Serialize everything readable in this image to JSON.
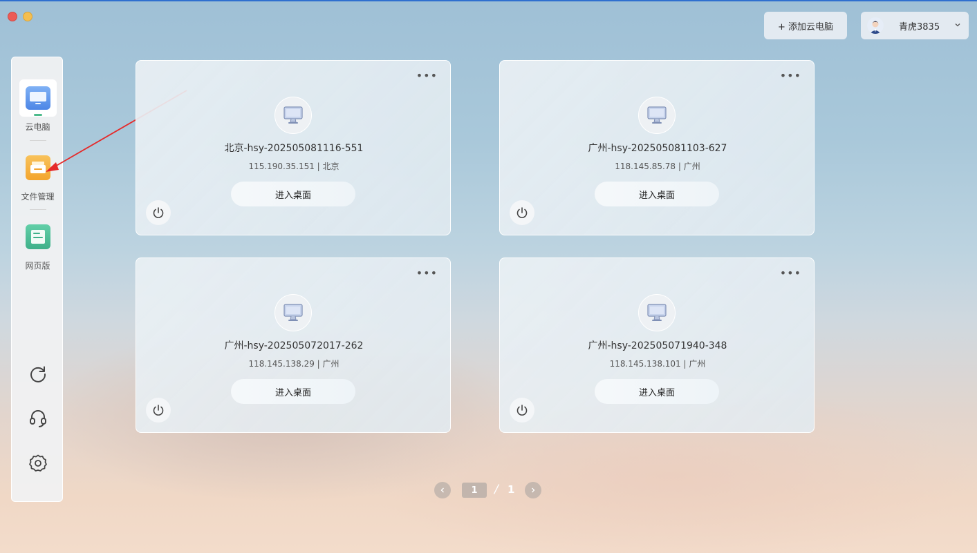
{
  "window": {
    "controls": [
      "close",
      "minimize"
    ]
  },
  "header": {
    "add_button": "+ 添加云电脑",
    "user": {
      "name": "青虎3835",
      "avatar_icon": "user-avatar-icon"
    }
  },
  "sidebar": {
    "items": [
      {
        "label": "云电脑",
        "icon": "monitor-icon",
        "active": true
      },
      {
        "label": "文件管理",
        "icon": "folder-icon",
        "active": false
      },
      {
        "label": "网页版",
        "icon": "web-page-icon",
        "active": false
      }
    ],
    "tools": [
      {
        "icon": "refresh-icon"
      },
      {
        "icon": "headset-icon"
      },
      {
        "icon": "settings-icon"
      }
    ]
  },
  "cards": [
    {
      "name": "北京-hsy-202505081116-551",
      "ip": "115.190.35.151 | 北京",
      "enter": "进入桌面"
    },
    {
      "name": "广州-hsy-202505081103-627",
      "ip": "118.145.85.78 | 广州",
      "enter": "进入桌面"
    },
    {
      "name": "广州-hsy-202505072017-262",
      "ip": "118.145.138.29 | 广州",
      "enter": "进入桌面"
    },
    {
      "name": "广州-hsy-202505071940-348",
      "ip": "118.145.138.101 | 广州",
      "enter": "进入桌面"
    }
  ],
  "pagination": {
    "current": "1",
    "separator": "/",
    "total": "1"
  },
  "colors": {
    "accent_green": "#4dbb8c",
    "annotation_arrow": "#e52a2a",
    "folder_orange": "#f6b23c",
    "web_green": "#4fbf9a"
  }
}
